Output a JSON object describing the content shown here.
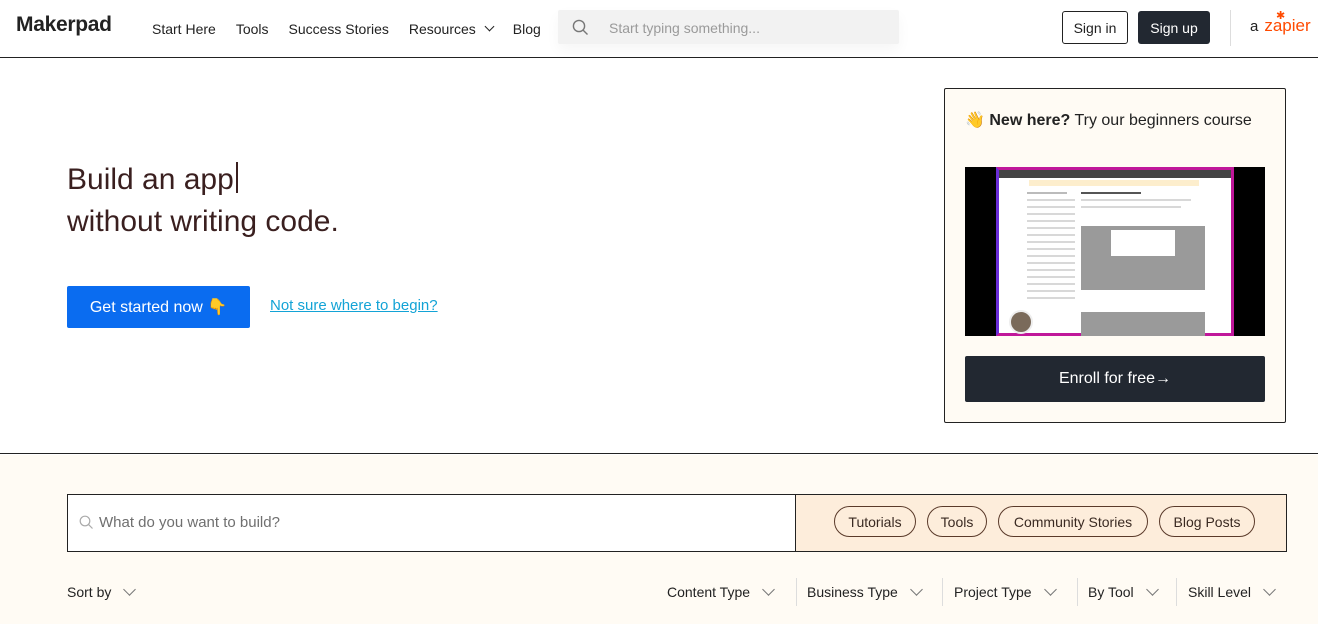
{
  "header": {
    "logo": "Makerpad",
    "nav": [
      {
        "label": "Start Here"
      },
      {
        "label": "Tools"
      },
      {
        "label": "Success Stories"
      },
      {
        "label": "Resources",
        "dropdown": true
      },
      {
        "label": "Blog"
      }
    ],
    "search_placeholder": "Start typing something...",
    "sign_in": "Sign in",
    "sign_up": "Sign up",
    "partner_prefix": "a",
    "partner_name": "zapier"
  },
  "hero": {
    "title_line1": "Build an app",
    "title_line2": "without writing code.",
    "cta": "Get started now 👇",
    "secondary_link": "Not sure where to begin?"
  },
  "course": {
    "emoji": "👋",
    "bold": "New here?",
    "rest": " Try our beginners course",
    "enroll": "Enroll for free→"
  },
  "search": {
    "placeholder": "What do you want to build?",
    "chips": [
      "Tutorials",
      "Tools",
      "Community Stories",
      "Blog Posts"
    ]
  },
  "filters": {
    "sort_label": "Sort by",
    "items": [
      "Content Type",
      "Business Type",
      "Project Type",
      "By Tool",
      "Skill Level"
    ]
  },
  "colors": {
    "primary_blue": "#0a6cf0",
    "dark_button": "#222831",
    "link": "#13a3d6",
    "cream": "#fffbf4",
    "zapier_orange": "#ff4a00"
  }
}
